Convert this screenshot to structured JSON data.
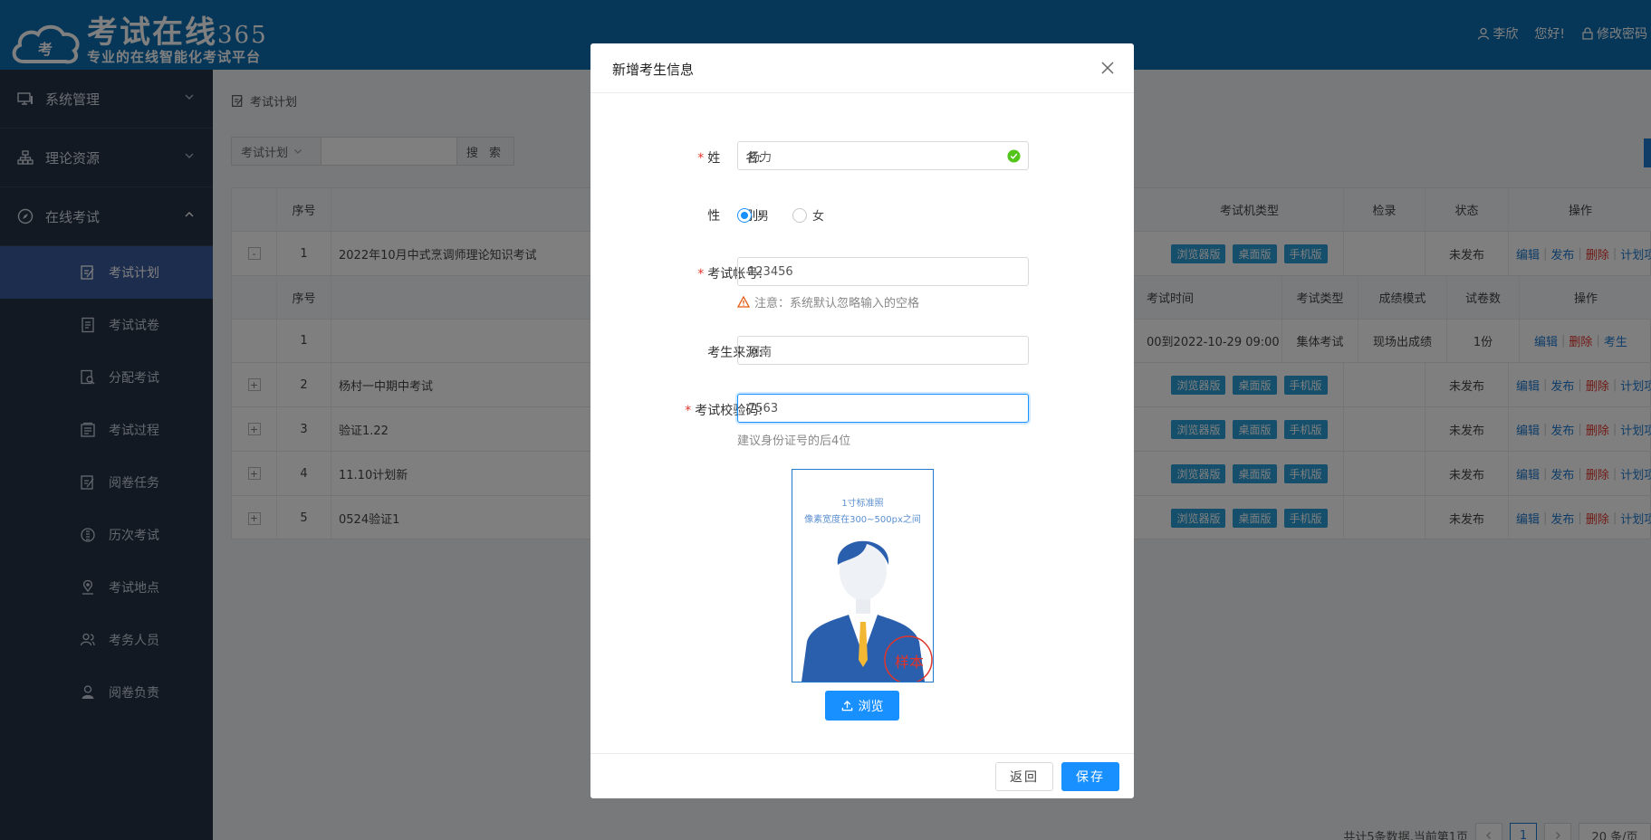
{
  "header": {
    "logo_title": "考试在线",
    "logo_num": "365",
    "logo_sub": "专业的在线智能化考试平台",
    "logo_badge": "考",
    "user": "李欣",
    "greeting": "您好!",
    "change_pwd": "修改密码"
  },
  "sidebar": {
    "groups": [
      {
        "label": "系统管理"
      },
      {
        "label": "理论资源"
      },
      {
        "label": "在线考试"
      }
    ],
    "items": [
      {
        "label": "考试计划"
      },
      {
        "label": "考试试卷"
      },
      {
        "label": "分配考试"
      },
      {
        "label": "考试过程"
      },
      {
        "label": "阅卷任务"
      },
      {
        "label": "历次考试"
      },
      {
        "label": "考试地点"
      },
      {
        "label": "考务人员"
      },
      {
        "label": "阅卷负责"
      }
    ]
  },
  "page": {
    "breadcrumb": "考试计划",
    "search_select": "考试计划",
    "search_button": "搜 索"
  },
  "table": {
    "headers": {
      "idx": "序号",
      "client": "考试机类型",
      "login": "检录",
      "status": "状态",
      "ops": "操作"
    },
    "client_tags": [
      "浏览器版",
      "桌面版",
      "手机版"
    ],
    "ops": {
      "edit": "编辑",
      "publish": "发布",
      "delete": "删除",
      "plan": "计划项"
    },
    "rows": [
      {
        "sign": "-",
        "idx": "1",
        "name": "2022年10月中式烹调师理论知识考试",
        "status": "未发布"
      },
      {
        "sign": "+",
        "idx": "2",
        "name": "杨村一中期中考试",
        "status": "未发布"
      },
      {
        "sign": "+",
        "idx": "3",
        "name": "验证1.22",
        "status": "未发布"
      },
      {
        "sign": "+",
        "idx": "4",
        "name": "11.10计划新",
        "status": "未发布"
      },
      {
        "sign": "+",
        "idx": "5",
        "name": "0524验证1",
        "status": "未发布"
      }
    ],
    "sub": {
      "headers": {
        "idx": "序号",
        "time": "考试时间",
        "type": "考试类型",
        "mode": "成绩模式",
        "papers": "试卷数",
        "ops": "操作"
      },
      "row": {
        "idx": "1",
        "time": "00到2022-10-29 09:00",
        "type": "集体考试",
        "mode": "现场出成绩",
        "papers": "1份",
        "edit": "编辑",
        "delete": "删除",
        "examinee": "考生"
      }
    }
  },
  "pager": {
    "summary": "共计5条数据,当前第1页",
    "current": "1",
    "size": "20 条/页"
  },
  "modal": {
    "title": "新增考生信息",
    "name_label": "姓　　名:",
    "name_value": "杨力",
    "gender_label": "性　　别:",
    "gender_male": "男",
    "gender_female": "女",
    "account_label": "考试帐号:",
    "account_value": "123456",
    "account_note": "注意：系统默认忽略输入的空格",
    "source_label": "考生来源:",
    "source_value": "河南",
    "code_label": "考试校验码:",
    "code_value": "7563",
    "code_hint": "建议身份证号的后4位",
    "photo_line1": "1寸标准照",
    "photo_line2": "像素宽度在300~500px之间",
    "photo_stamp": "样本",
    "browse": "浏览",
    "back": "返回",
    "save": "保存"
  },
  "colors": {
    "header": "#0c6eb3",
    "sidebar": "#263246",
    "active": "#3a5a9a",
    "primary": "#1890ff",
    "tag": "#2a9fd6",
    "danger": "#e0342b"
  }
}
